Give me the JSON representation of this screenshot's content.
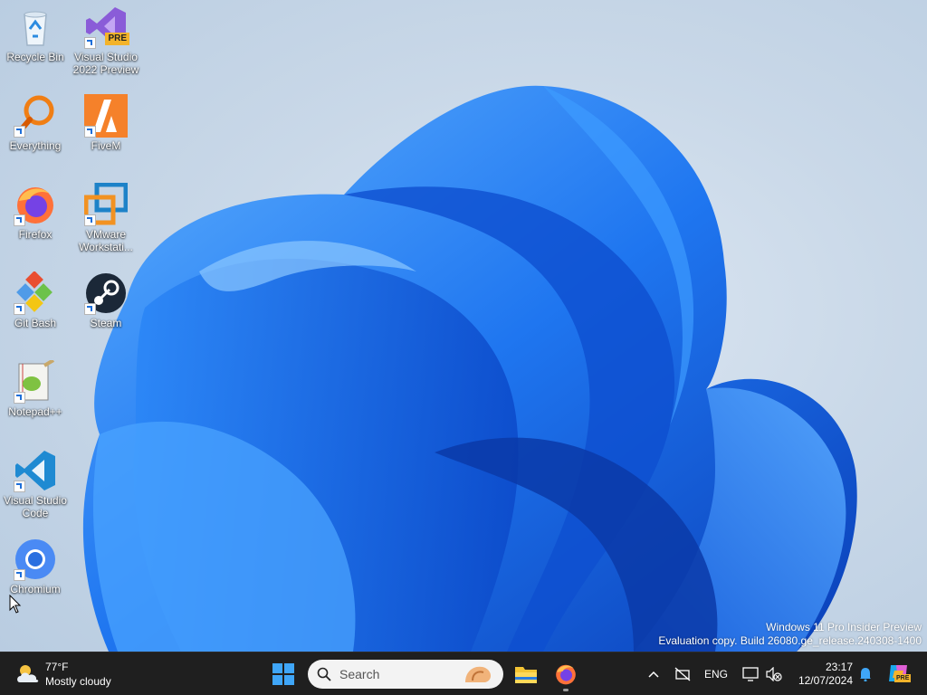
{
  "desktop": {
    "icons": [
      {
        "label": "Recycle Bin",
        "icon": "recycle-bin-icon",
        "shortcut": false
      },
      {
        "label": "Visual Studio 2022 Preview",
        "icon": "visual-studio-icon",
        "shortcut": true,
        "badge": "PRE"
      },
      {
        "label": "Everything",
        "icon": "everything-icon",
        "shortcut": true
      },
      {
        "label": "FiveM",
        "icon": "fivem-icon",
        "shortcut": true
      },
      {
        "label": "Firefox",
        "icon": "firefox-icon",
        "shortcut": true
      },
      {
        "label": "VMware Workstati...",
        "icon": "vmware-icon",
        "shortcut": true
      },
      {
        "label": "Git Bash",
        "icon": "git-bash-icon",
        "shortcut": true
      },
      {
        "label": "Steam",
        "icon": "steam-icon",
        "shortcut": true
      },
      {
        "label": "Notepad++",
        "icon": "notepad-plus-plus-icon",
        "shortcut": true
      },
      {
        "label": "Visual Studio Code",
        "icon": "vscode-icon",
        "shortcut": true
      },
      {
        "label": "Chromium",
        "icon": "chromium-icon",
        "shortcut": true
      }
    ],
    "watermark": {
      "line1": "Windows 11 Pro Insider Preview",
      "line2": "Evaluation copy. Build 26080.ge_release.240308-1400"
    }
  },
  "taskbar": {
    "weather": {
      "temp": "77°F",
      "condition": "Mostly cloudy",
      "icon": "cloudy-weather-icon"
    },
    "start_icon": "windows-start-icon",
    "search": {
      "placeholder": "Search",
      "icon": "search-icon"
    },
    "apps": [
      {
        "name": "File Explorer",
        "icon": "file-explorer-icon",
        "active": false
      },
      {
        "name": "Firefox",
        "icon": "firefox-icon",
        "active": true
      }
    ],
    "tray": {
      "overflow_icon": "chevron-up-icon",
      "network_icon": "network-disconnected-icon",
      "language": "ENG",
      "display_icon": "display-icon",
      "volume_icon": "volume-muted-icon"
    },
    "clock": {
      "time": "23:17",
      "date": "12/07/2024"
    },
    "notification_icon": "bell-icon",
    "copilot_badge": "PRE"
  },
  "colors": {
    "accent": "#1e6fd9",
    "taskbar": "#1f1f1f",
    "bloom_dark": "#0a3fb8",
    "bloom_light": "#3d9bff"
  }
}
